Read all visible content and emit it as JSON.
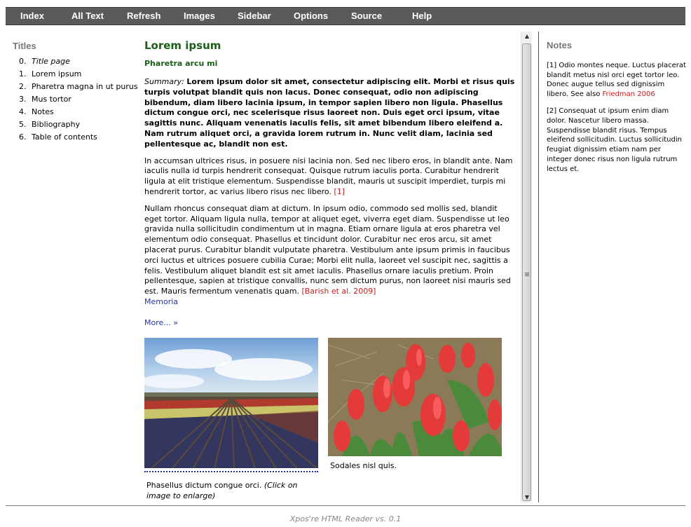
{
  "nav": {
    "items": [
      "Index",
      "All Text",
      "Refresh",
      "Images",
      "Sidebar",
      "Options",
      "Source",
      "Help"
    ],
    "bg": "#5a5a5a"
  },
  "titles": {
    "heading": "Titles",
    "items": [
      {
        "num": "0.",
        "label": "Title page"
      },
      {
        "num": "1.",
        "label": "Lorem ipsum"
      },
      {
        "num": "2.",
        "label": "Pharetra magna in ut purus"
      },
      {
        "num": "3.",
        "label": "Mus tortor"
      },
      {
        "num": "4.",
        "label": "Notes"
      },
      {
        "num": "5.",
        "label": "Bibliography"
      },
      {
        "num": "6.",
        "label": "Table of contents"
      }
    ]
  },
  "main": {
    "title": "Lorem ipsum",
    "subtitle": "Pharetra arcu mi",
    "summary_label": "Summary:",
    "summary_text": "Lorem ipsum dolor sit amet, consectetur adipiscing elit. Morbi et risus quis turpis volutpat blandit quis non lacus. Donec consequat, odio non adipiscing bibendum, diam libero lacinia ipsum, in tempor sapien libero non ligula. Phasellus dictum congue orci, nec scelerisque risus laoreet non. Duis eget orci ipsum, vitae sagittis nunc. Aliquam venenatis iaculis felis, sit amet bibendum libero eleifend a. Nam rutrum aliquet orci, a gravida lorem rutrum in. Nunc velit diam, lacinia sed pellentesque ac, blandit non est.",
    "para1": "In accumsan ultrices risus, in posuere nisi lacinia non. Sed nec libero eros, in blandit ante. Nam iaculis nulla id turpis hendrerit consequat. Quisque rutrum iaculis porta. Curabitur hendrerit ligula at elit tristique elementum. Suspendisse blandit, mauris ut suscipit imperdiet, turpis mi hendrerit tortor, ac varius libero risus nec libero.",
    "para1_ref": "[1]",
    "para2": "Nullam rhoncus consequat diam at dictum. In ipsum odio, commodo sed mollis sed, blandit eget tortor. Aliquam ligula nulla, tempor at aliquet eget, viverra eget diam. Suspendisse ut leo gravida nulla sollicitudin condimentum ut in magna. Etiam ornare ligula at eros pharetra vel elementum odio consequat. Phasellus et tincidunt dolor. Curabitur nec eros arcu, sit amet placerat purus. Curabitur blandit vulputate pharetra. Vestibulum ante ipsum primis in faucibus orci luctus et ultrices posuere cubilia Curae; Morbi elit nulla, laoreet vel suscipit nec, sagittis a felis. Vestibulum aliquet blandit est sit amet iaculis. Phasellus ornare iaculis pretium. Proin pellentesque, sapien at tristique convallis, nunc sem dictum purus, non laoreet nisi mauris sed est. Mauris fermentum venenatis quam.",
    "para2_ref": "[Barish et al. 2009]",
    "para2_link": "Memoria",
    "more": "More... »",
    "image1_caption": "Phasellus dictum congue orci.",
    "image1_caption_hint": "(Click on image to enlarge)",
    "image2_caption": "Sodales nisl quis."
  },
  "notes": {
    "heading": "Notes",
    "note1": "[1] Odio montes neque. Luctus placerat blandit metus nisl orci eget tortor leo. Donec augue tellus sed dignissim libero. See also",
    "note1_ref": "Friedman 2006",
    "note2": "[2] Consequat ut ipsum enim diam dolor. Nascetur libero massa. Suspendisse blandit risus. Tempus eleifend sollicitudin. Luctus sollicitudin feugiat dignissim etiam nam per integer donec risus non ligula rutrum lectus et."
  },
  "footer": "Xpos're HTML Reader vs. 0.1",
  "colors": {
    "heading_green": "#1a5e1a",
    "ref_red": "#c81e1e",
    "link_blue": "#2233aa"
  }
}
